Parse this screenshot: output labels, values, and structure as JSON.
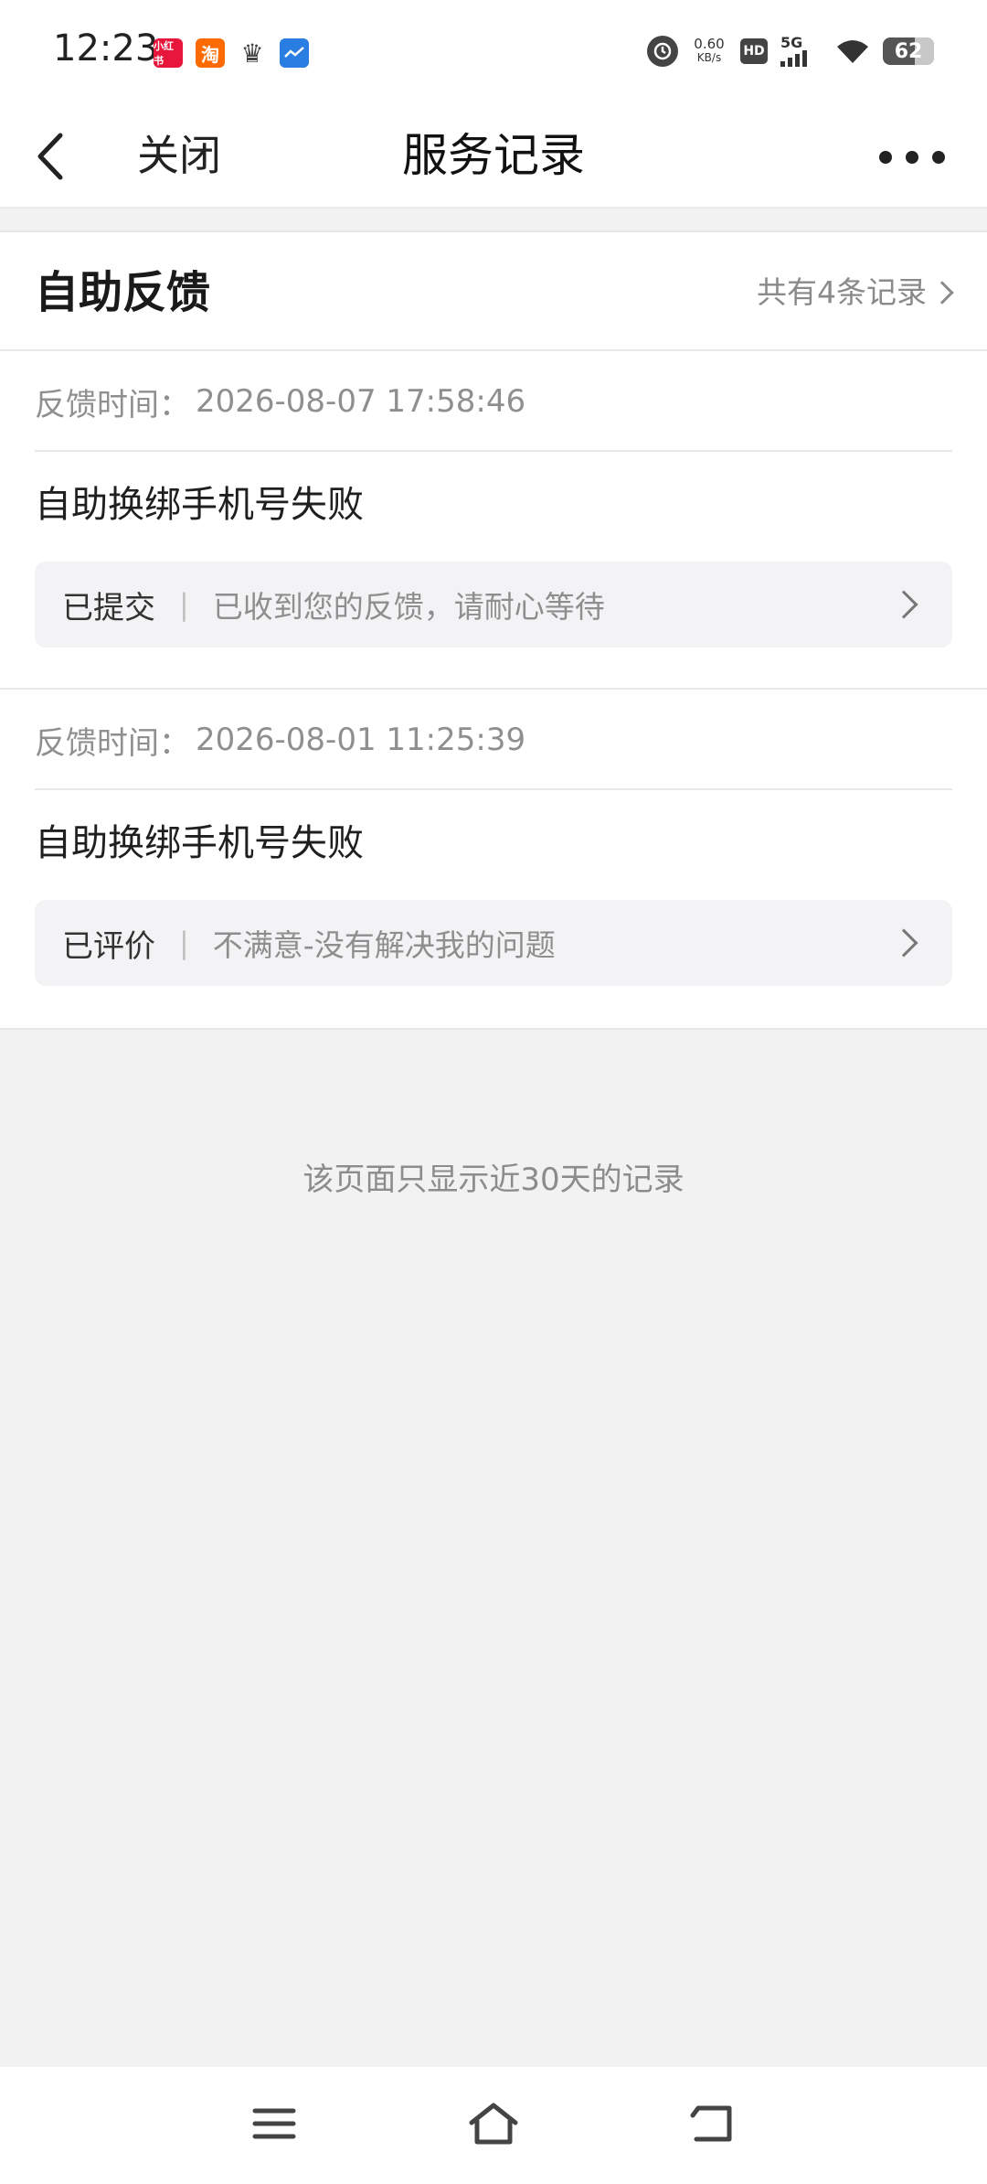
{
  "status_bar": {
    "time": "12:23",
    "net_speed_value": "0.60",
    "net_speed_unit": "KB/s",
    "hd_label": "HD",
    "network_label": "5G",
    "battery": "62",
    "notification_icons": [
      "xiaodian-app-icon",
      "taobao-icon",
      "crown-icon",
      "weather-icon"
    ],
    "taobao_glyph": "淘",
    "xiaodian_glyph": "小红书"
  },
  "nav": {
    "close_label": "关闭",
    "title": "服务记录"
  },
  "section": {
    "title": "自助反馈",
    "count_text": "共有4条记录"
  },
  "records": [
    {
      "time_label": "反馈时间：",
      "time_value": "2026-08-07 17:58:46",
      "title": "自助换绑手机号失败",
      "status": "已提交",
      "separator": "|",
      "message": "已收到您的反馈，请耐心等待"
    },
    {
      "time_label": "反馈时间：",
      "time_value": "2026-08-01 11:25:39",
      "title": "自助换绑手机号失败",
      "status": "已评价",
      "separator": "|",
      "message": "不满意-没有解决我的问题"
    }
  ],
  "footer_note": "该页面只显示近30天的记录",
  "colors": {
    "background": "#f2f2f2",
    "card": "#ffffff",
    "muted_text": "#8c8c8c",
    "status_box": "#f3f3f5"
  }
}
